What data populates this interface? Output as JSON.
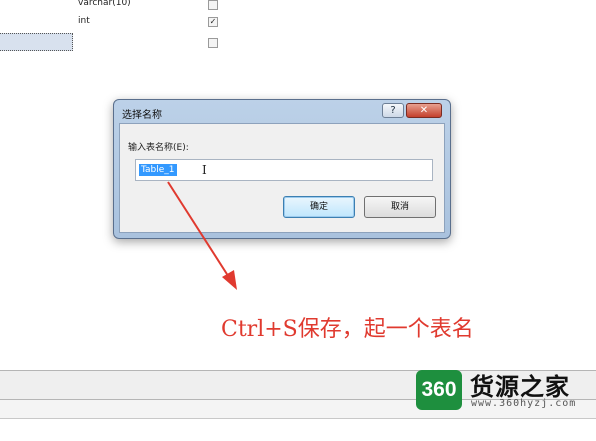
{
  "designer": {
    "rows": [
      {
        "type": "varchar(10)",
        "allow_nulls": false
      },
      {
        "type": "int",
        "allow_nulls": true
      },
      {
        "type": "",
        "allow_nulls": false
      }
    ],
    "check_mark": "✓"
  },
  "dialog": {
    "title": "选择名称",
    "help_label": "?",
    "close_label": "✕",
    "prompt": "输入表名称(E):",
    "input_value": "Table_1",
    "cursor_glyph": "I",
    "ok_label": "确定",
    "cancel_label": "取消"
  },
  "annotation": {
    "text": "Ctrl+S保存，起一个表名",
    "color": "#e03a2f"
  },
  "watermark": {
    "badge": "360",
    "name": "货源之家",
    "url": "www.360hyzj.com"
  }
}
